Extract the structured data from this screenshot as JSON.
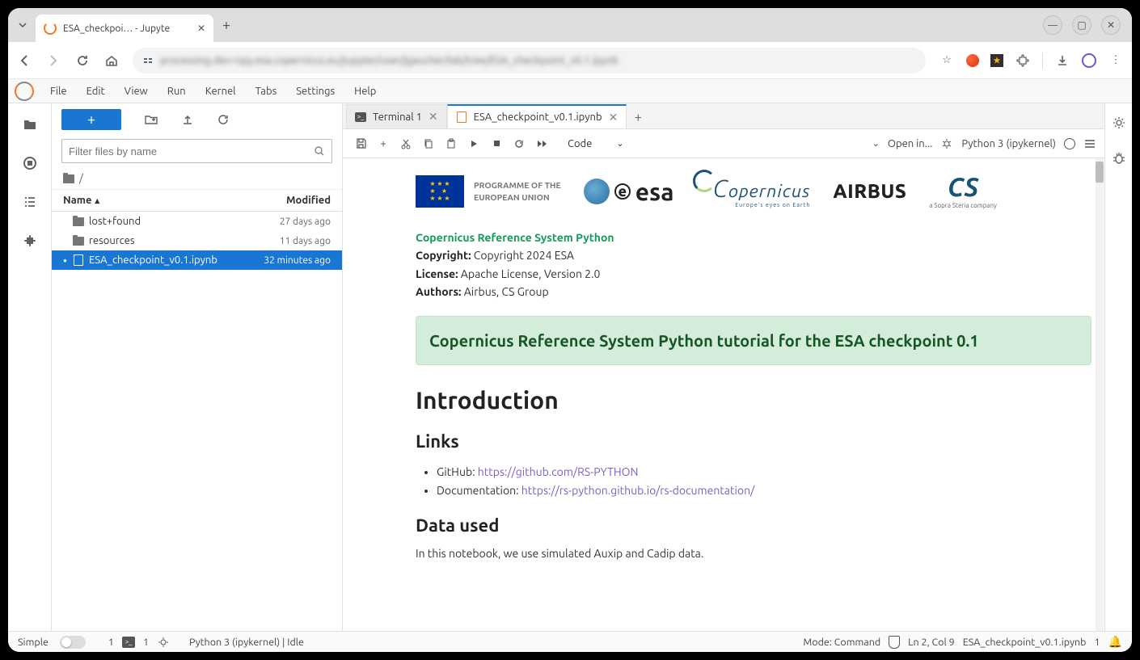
{
  "browser": {
    "tab_title": "ESA_checkpoi… - Jupyte",
    "url_text": "processing.dev-rspy.esa.copernicus.eu/jupyter/user/jgaucher/lab/tree/ESA_checkpoint_v0.1.ipynb"
  },
  "menu": [
    "File",
    "Edit",
    "View",
    "Run",
    "Kernel",
    "Tabs",
    "Settings",
    "Help"
  ],
  "file_panel": {
    "filter_placeholder": "Filter files by name",
    "breadcrumb": "/",
    "columns": {
      "name": "Name",
      "modified": "Modified"
    },
    "items": [
      {
        "type": "folder",
        "name": "lost+found",
        "modified": "27 days ago",
        "selected": false,
        "bullet": false
      },
      {
        "type": "folder",
        "name": "resources",
        "modified": "11 days ago",
        "selected": false,
        "bullet": false
      },
      {
        "type": "notebook",
        "name": "ESA_checkpoint_v0.1.ipynb",
        "modified": "32 minutes ago",
        "selected": true,
        "bullet": true
      }
    ]
  },
  "tabs": [
    {
      "kind": "terminal",
      "label": "Terminal 1",
      "active": false
    },
    {
      "kind": "notebook",
      "label": "ESA_checkpoint_v0.1.ipynb",
      "active": true
    }
  ],
  "nb_toolbar": {
    "cell_type": "Code",
    "open_in": "Open in...",
    "kernel": "Python 3 (ipykernel)"
  },
  "content": {
    "eu_text_1": "PROGRAMME OF THE",
    "eu_text_2": "EUROPEAN UNION",
    "esa": "esa",
    "copernicus": "opernicus",
    "cop_sub": "Europe's eyes on Earth",
    "airbus": "AIRBUS",
    "cs": "CS",
    "cs_sub": "a Sopra Steria company",
    "title_link": "Copernicus Reference System Python",
    "copyright_label": "Copyright:",
    "copyright_val": " Copyright 2024 ESA",
    "license_label": "License:",
    "license_val": " Apache License, Version 2.0",
    "authors_label": "Authors:",
    "authors_val": " Airbus, CS Group",
    "banner": "Copernicus Reference System Python tutorial for the ESA checkpoint 0.1",
    "h1": "Introduction",
    "h2_links": "Links",
    "github_label": "GitHub: ",
    "github_url": "https://github.com/RS-PYTHON",
    "doc_label": "Documentation: ",
    "doc_url": "https://rs-python.github.io/rs-documentation/",
    "h2_data": "Data used",
    "body1": "In this notebook, we use simulated Auxip and Cadip data."
  },
  "status": {
    "simple": "Simple",
    "terms": "1",
    "terms2": "1",
    "kernel": "Python 3 (ipykernel) | Idle",
    "mode": "Mode: Command",
    "ln": "Ln 2, Col 9",
    "file": "ESA_checkpoint_v0.1.ipynb",
    "count": "1"
  }
}
